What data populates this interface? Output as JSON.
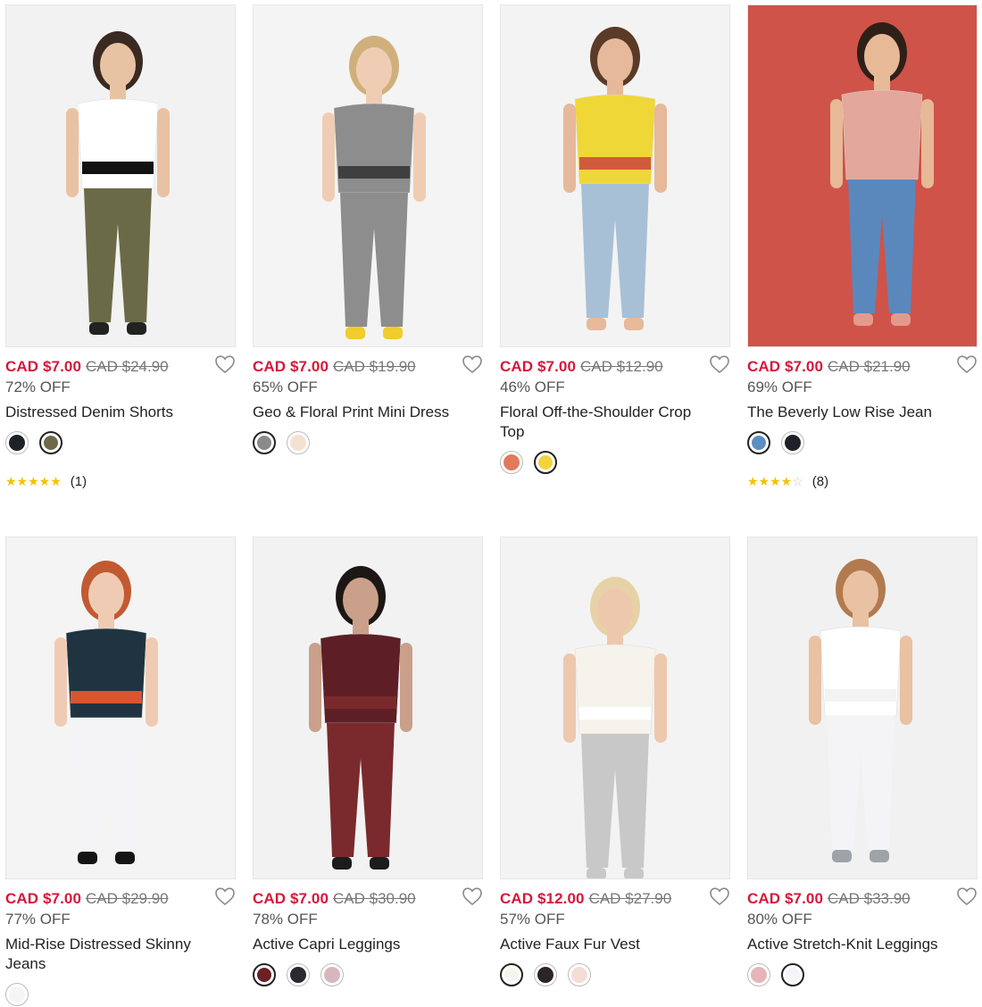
{
  "products": [
    {
      "sale_price": "CAD $7.00",
      "original_price": "CAD $24.90",
      "discount": "72% OFF",
      "name": "Distressed Denim Shorts",
      "swatches": [
        {
          "color": "#1f2128",
          "selected": false
        },
        {
          "color": "#6e6a49",
          "selected": true
        }
      ],
      "rating": {
        "stars": "★★★★★",
        "empty": "",
        "count": "(1)"
      }
    },
    {
      "sale_price": "CAD $7.00",
      "original_price": "CAD $19.90",
      "discount": "65% OFF",
      "name": "Geo & Floral Print Mini Dress",
      "swatches": [
        {
          "color": "#8a8a8a",
          "selected": true
        },
        {
          "color": "#f3e2d2",
          "selected": false
        }
      ],
      "rating": null
    },
    {
      "sale_price": "CAD $7.00",
      "original_price": "CAD $12.90",
      "discount": "46% OFF",
      "name": "Floral Off-the-Shoulder Crop Top",
      "swatches": [
        {
          "color": "#e07a5a",
          "selected": false
        },
        {
          "color": "#f1d33b",
          "selected": true
        }
      ],
      "rating": null
    },
    {
      "sale_price": "CAD $7.00",
      "original_price": "CAD $21.90",
      "discount": "69% OFF",
      "name": "The Beverly Low Rise Jean",
      "swatches": [
        {
          "color": "#5b8fc4",
          "selected": true
        },
        {
          "color": "#1f2128",
          "selected": false
        }
      ],
      "rating": {
        "stars": "★★★★",
        "empty": "☆",
        "count": "(8)"
      }
    },
    {
      "sale_price": "CAD $7.00",
      "original_price": "CAD $29.90",
      "discount": "77% OFF",
      "name": "Mid-Rise Distressed Skinny Jeans",
      "swatches": [
        {
          "color": "#f4f5f7",
          "selected": false
        }
      ],
      "rating": null
    },
    {
      "sale_price": "CAD $7.00",
      "original_price": "CAD $30.90",
      "discount": "78% OFF",
      "name": "Active Capri Leggings",
      "swatches": [
        {
          "color": "#6b2025",
          "selected": true
        },
        {
          "color": "#2a2a2e",
          "selected": false
        },
        {
          "color": "#d7b7bd",
          "selected": false
        }
      ],
      "rating": null
    },
    {
      "sale_price": "CAD $12.00",
      "original_price": "CAD $27.90",
      "discount": "57% OFF",
      "name": "Active Faux Fur Vest",
      "swatches": [
        {
          "color": "#f5f4ef",
          "selected": true
        },
        {
          "color": "#2c2527",
          "selected": false
        },
        {
          "color": "#f3ddd6",
          "selected": false
        }
      ],
      "rating": null
    },
    {
      "sale_price": "CAD $7.00",
      "original_price": "CAD $33.90",
      "discount": "80% OFF",
      "name": "Active Stretch-Knit Leggings",
      "swatches": [
        {
          "color": "#e4b6b8",
          "selected": false
        },
        {
          "color": "#f4f5f8",
          "selected": true
        }
      ],
      "rating": null
    }
  ],
  "images": [
    {
      "icon": "product-photo",
      "bg": "#f2f2f2",
      "skin": "#e8c3a3",
      "top": "#ffffff",
      "band": "#111111",
      "bottom": "#6b6a47",
      "hair": "#3a2a22",
      "shoe": "#222"
    },
    {
      "icon": "product-photo",
      "bg": "#f4f4f4",
      "skin": "#efcdb4",
      "top": "#8d8d8d",
      "band": "#3f3f3f",
      "bottom": "#8d8d8d",
      "hair": "#cfb07c",
      "shoe": "#f1cc2c"
    },
    {
      "icon": "product-photo",
      "bg": "#f3f3f3",
      "skin": "#e6b99a",
      "top": "#efd737",
      "band": "#d25a3c",
      "bottom": "#a8c0d6",
      "hair": "#5a3b28",
      "shoe": "#e6b99a"
    },
    {
      "icon": "product-photo",
      "bg": "#cf5349",
      "skin": "#e7b996",
      "top": "#e3a79c",
      "band": "#e3a79c",
      "bottom": "#5a88bd",
      "hair": "#2e2018",
      "shoe": "#e39a8d"
    },
    {
      "icon": "product-photo",
      "bg": "#f4f4f4",
      "skin": "#f0cbb4",
      "top": "#1f3440",
      "band": "#d8562c",
      "bottom": "#f4f4f6",
      "hair": "#c25a31",
      "shoe": "#151515"
    },
    {
      "icon": "product-photo",
      "bg": "#f2f2f2",
      "skin": "#caa08a",
      "top": "#5d1f25",
      "band": "#7a2a2c",
      "bottom": "#7a2a2c",
      "hair": "#1c1714",
      "shoe": "#1c1c1c"
    },
    {
      "icon": "product-photo",
      "bg": "#f3f3f3",
      "skin": "#edc8ad",
      "top": "#f6f3ec",
      "band": "#ffffff",
      "bottom": "#c8c8c8",
      "hair": "#e7d2a7",
      "shoe": "#c8c8c8"
    },
    {
      "icon": "product-photo",
      "bg": "#f1f1f1",
      "skin": "#e9c1a3",
      "top": "#ffffff",
      "band": "#f3f3f3",
      "bottom": "#f4f4f6",
      "hair": "#b27a4e",
      "shoe": "#9ea3a8"
    }
  ]
}
